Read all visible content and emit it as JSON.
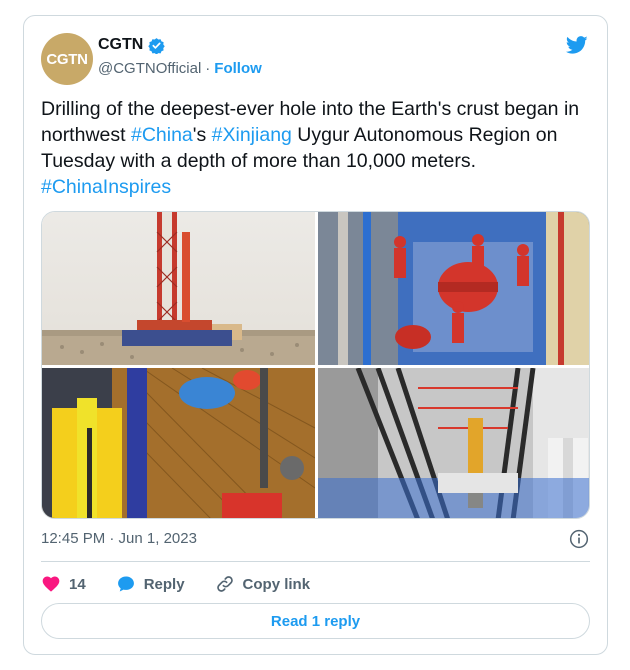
{
  "author": {
    "avatar_text": "CGTN",
    "name": "CGTN",
    "handle": "@CGTNOfficial",
    "separator": "·",
    "follow_label": "Follow"
  },
  "tweet": {
    "part1": "Drilling of the deepest-ever hole into the Earth's crust began in northwest ",
    "tag_china": "#China",
    "part2": "'s ",
    "tag_xinjiang": "#Xinjiang",
    "part3": " Uygur Autonomous Region on Tuesday with a depth of more than 10,000 meters. ",
    "tag_inspires": "#ChinaInspires"
  },
  "meta": {
    "timestamp": "12:45 PM · Jun 1, 2023"
  },
  "actions": {
    "likes_count": "14",
    "reply_label": "Reply",
    "copy_label": "Copy link"
  },
  "read_replies_label": "Read 1 reply",
  "colors": {
    "accent": "#1d9bf0",
    "like": "#f91880",
    "avatar_bg": "#c8a968"
  },
  "icons": [
    "verified-badge-icon",
    "twitter-bird-icon",
    "info-icon",
    "heart-icon",
    "reply-bubble-icon",
    "link-icon"
  ]
}
